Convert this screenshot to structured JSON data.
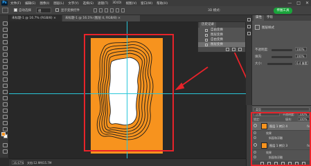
{
  "app": {
    "logo": "Ps"
  },
  "menu": [
    "文件(F)",
    "编辑(E)",
    "图像(I)",
    "图层(L)",
    "文字(Y)",
    "选择(S)",
    "滤镜(T)",
    "3D(D)",
    "视图(V)",
    "窗口(W)",
    "帮助(H)"
  ],
  "window_controls": [
    "—",
    "□",
    "✕"
  ],
  "options": {
    "auto_select_label": "自动选择",
    "auto_select_value": "组",
    "show_transform_label": "显示变换控件",
    "mode_label": "3D 模式:"
  },
  "badge": "传图工具",
  "tabs": [
    {
      "label": "未标题-1 @ 16.7% (RGB/8) ×"
    },
    {
      "label": "未标题-1 @ 16.1% (图层 4, RGB/8) × ",
      "active": true
    }
  ],
  "status": {
    "zoom": "16.67%",
    "doc_info": "文档:12.9M/15.7M"
  },
  "history": {
    "tab": "历史记录",
    "items": [
      "自由变换",
      "图层变换",
      "自由变换",
      "图层变换"
    ],
    "active_index": 3
  },
  "properties": {
    "tabs": [
      "属性",
      "字符"
    ],
    "section": "图层样式",
    "opacity_label": "不透明度:",
    "opacity_value": "100%",
    "fill_label": "填充:",
    "fill_value": "100%",
    "size_label": "大小:",
    "size_value": "6.4 像素"
  },
  "layers": {
    "kind_label": "类型",
    "blend_mode": "正常",
    "opacity_label": "不透明度:",
    "opacity_value": "100%",
    "lock_label": "锁定:",
    "fill_label": "填充:",
    "fill_value": "100%",
    "rows": [
      {
        "name": "图层 1 拷贝 4",
        "fx": "fx",
        "selected": true,
        "effects_label": "效果",
        "effect": "斜面和浮雕"
      },
      {
        "name": "图层 1 拷贝 3",
        "fx": "fx",
        "selected": false,
        "effects_label": "效果",
        "effect": "斜面和浮雕"
      }
    ]
  },
  "colors": {
    "accent_orange": "#f7931e",
    "guide_cyan": "#29c6d9",
    "highlight_red": "#e8232a",
    "badge_green": "#19a43a"
  }
}
